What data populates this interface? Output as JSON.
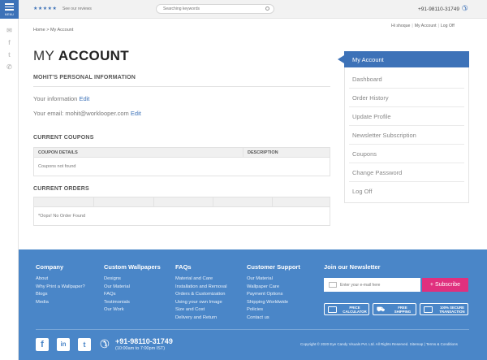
{
  "topbar": {
    "menu_label": "MENU",
    "stars": "★★★★★",
    "reviews_label": "See our reviews",
    "search_placeholder": "Searching keywords",
    "phone": "+91-98110-31749"
  },
  "breadcrumb": {
    "home": "Home",
    "sep": " > ",
    "current": "My Account"
  },
  "user_links": {
    "greeting": "Hi shoque",
    "account": "My Account",
    "logout": "Log Off",
    "sep": "|"
  },
  "page": {
    "title_light": "MY",
    "title_bold": "ACCOUNT",
    "personal_heading": "MOHIT'S PERSONAL INFORMATION",
    "info_label": "Your information",
    "info_edit": "Edit",
    "email_label": "Your email: mohit@worklooper.com",
    "email_edit": "Edit",
    "coupons_heading": "CURRENT COUPONS",
    "coupons_columns": [
      "COUPON DETAILS",
      "DESCRIPTION"
    ],
    "coupons_empty": "Coupons not found",
    "orders_heading": "CURRENT ORDERS",
    "orders_empty": "*Oops! No Order Found"
  },
  "sidebar": {
    "active": "My Account",
    "items": [
      "Dashboard",
      "Order History",
      "Update Profile",
      "Newsletter Subscription",
      "Coupons",
      "Change Password",
      "Log Off"
    ]
  },
  "footer": {
    "company": {
      "heading": "Company",
      "links": [
        "About",
        "Why Print a Wallpaper?",
        "Blogs",
        "Media"
      ]
    },
    "custom": {
      "heading": "Custom Wallpapers",
      "links": [
        "Designs",
        "Our Material",
        "FAQs",
        "Testimonials",
        "Our Work"
      ]
    },
    "faqs": {
      "heading": "FAQs",
      "links": [
        "Material and Care",
        "Installation and Removal",
        "Orders & Customization",
        "Using your own Image",
        "Size and Cost",
        "Delivery and Return"
      ]
    },
    "support": {
      "heading": "Customer Support",
      "links": [
        "Our Material",
        "Wallpaper Care",
        "Payment Options",
        "Shipping Worldwide",
        "Policies",
        "Contact us"
      ]
    },
    "newsletter": {
      "heading": "Join our Newsletter",
      "placeholder": "Enter your e-mail here",
      "button": "+ Subscribe",
      "badges": [
        {
          "top": "PRICE",
          "bottom": "CALCULATOR"
        },
        {
          "top": "FREE",
          "bottom": "SHIPPING"
        },
        {
          "top": "100% SECURE",
          "bottom": "TRANSACTION"
        }
      ]
    },
    "phone": "+91-98110-31749",
    "hours": "(10:00am to 7:00pm IST)",
    "copyright": "Copyright © 2020 Eye Candy Visuals Pvt. Ltd. All Rights Reserved. Sitemap | Terms & Conditions"
  },
  "colors": {
    "accent": "#3d72b8",
    "footer_bg": "#4a86c8",
    "subscribe": "#e0307e"
  }
}
